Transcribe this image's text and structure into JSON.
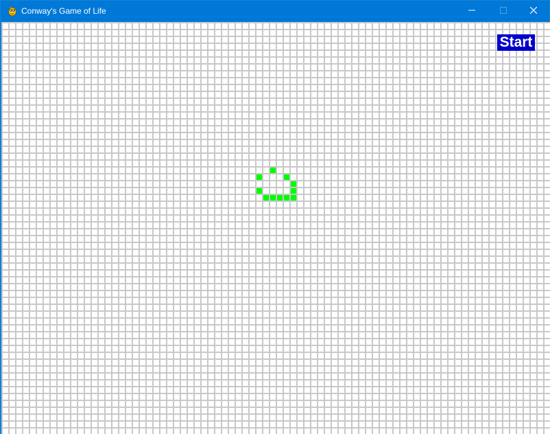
{
  "window": {
    "title": "Conway's Game of Life",
    "app_icon": "pygame-snake-icon",
    "controls": {
      "minimize_icon": "minimize-icon",
      "maximize_icon": "maximize-icon",
      "close_icon": "close-icon"
    },
    "titlebar_color": "#0078d7"
  },
  "board": {
    "grid_line_color": "#c8c8c8",
    "background_color": "#ffffff",
    "live_cell_color": "#00ff00",
    "live_cells": [
      {
        "col": 39,
        "row": 21
      },
      {
        "col": 37,
        "row": 22
      },
      {
        "col": 41,
        "row": 22
      },
      {
        "col": 42,
        "row": 23
      },
      {
        "col": 37,
        "row": 24
      },
      {
        "col": 42,
        "row": 24
      },
      {
        "col": 38,
        "row": 25
      },
      {
        "col": 39,
        "row": 25
      },
      {
        "col": 40,
        "row": 25
      },
      {
        "col": 41,
        "row": 25
      },
      {
        "col": 42,
        "row": 25
      }
    ]
  },
  "controls": {
    "start_label": "Start",
    "start_color": "#0000cc"
  }
}
